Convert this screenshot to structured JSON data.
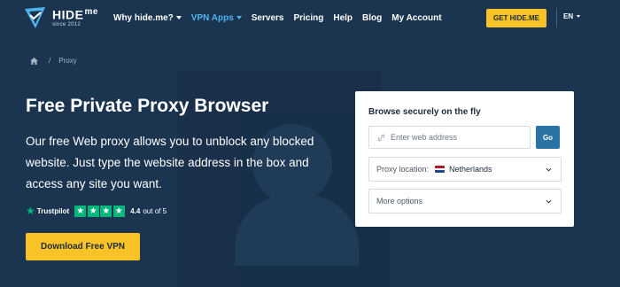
{
  "brand": {
    "name": "HIDE",
    "name_suffix": "me",
    "since": "since 2012",
    "logo_icon": "hide-me-logo-icon"
  },
  "nav": {
    "items": [
      {
        "label": "Why hide.me?",
        "has_dropdown": true,
        "active": false
      },
      {
        "label": "VPN Apps",
        "has_dropdown": true,
        "active": true
      },
      {
        "label": "Servers",
        "has_dropdown": false,
        "active": false
      },
      {
        "label": "Pricing",
        "has_dropdown": false,
        "active": false
      },
      {
        "label": "Help",
        "has_dropdown": false,
        "active": false
      },
      {
        "label": "Blog",
        "has_dropdown": false,
        "active": false
      },
      {
        "label": "My Account",
        "has_dropdown": false,
        "active": false
      }
    ],
    "cta_label": "GET HIDE.ME",
    "language": "EN"
  },
  "breadcrumb": {
    "home_icon": "home-icon",
    "separator": "/",
    "current": "Proxy"
  },
  "hero": {
    "title": "Free Private Proxy Browser",
    "text": "Our free Web proxy allows you to unblock any blocked website. Just type the website address in the box and access any site you want.",
    "trustpilot": {
      "brand": "Trustpilot",
      "stars": 4.4,
      "max_stars": 5,
      "rating": "4.4",
      "out_of": "out of 5"
    },
    "download_label": "Download Free VPN"
  },
  "proxy_card": {
    "title": "Browse securely on the fly",
    "url_placeholder": "Enter web address",
    "go_label": "Go",
    "location_label": "Proxy location:",
    "location_value": "Netherlands",
    "more_label": "More options"
  },
  "colors": {
    "background": "#1b3550",
    "accent_yellow": "#f9c328",
    "accent_blue": "#4fb3f0",
    "go_button": "#2a73a5",
    "trustpilot_green": "#00b67a"
  }
}
